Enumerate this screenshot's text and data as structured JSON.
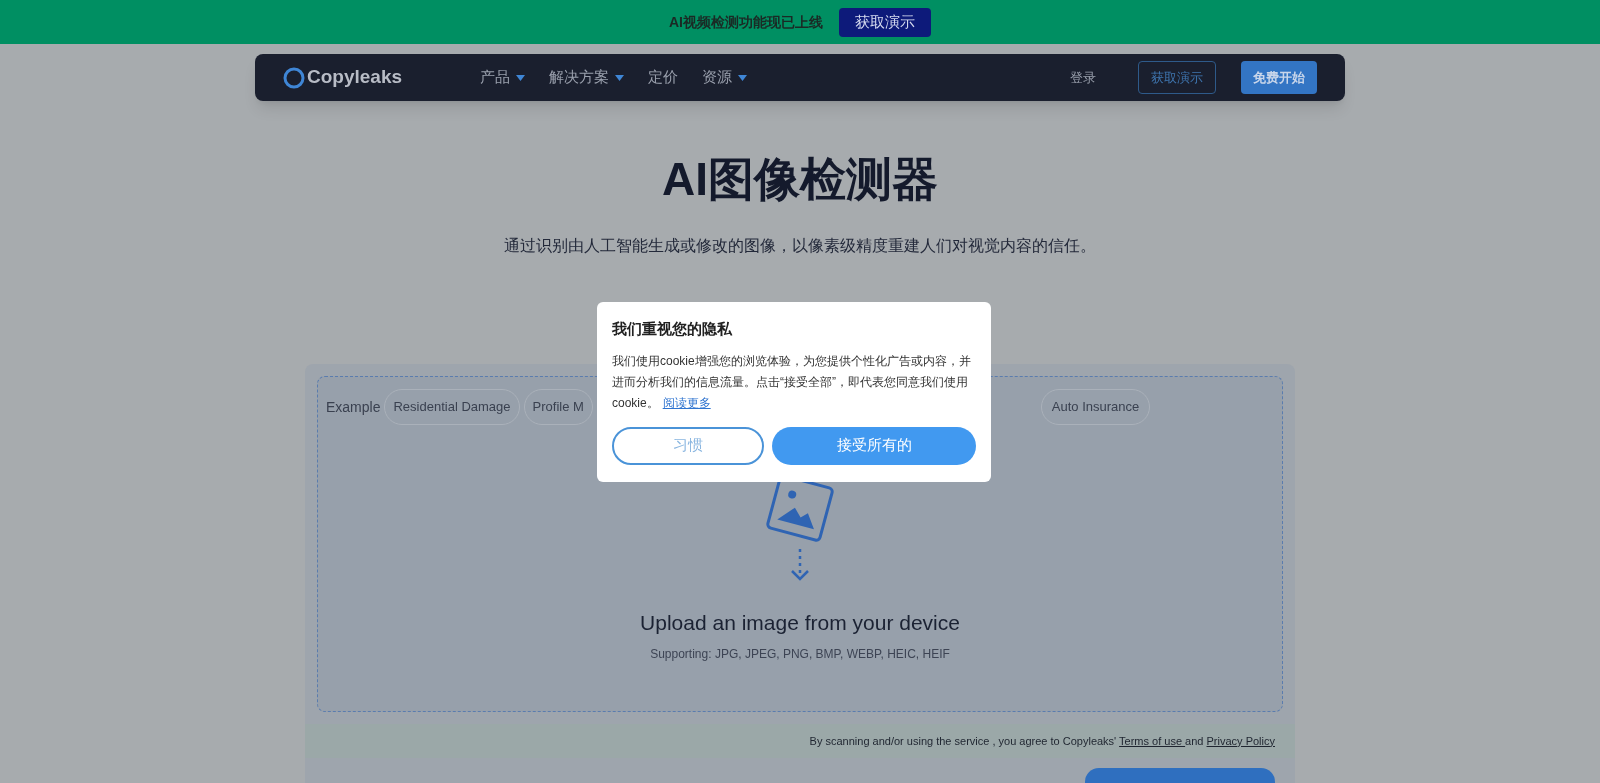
{
  "banner": {
    "text": "AI视频检测功能现已上线",
    "button": "获取演示"
  },
  "nav": {
    "logo": "Copyleaks",
    "items": [
      {
        "label": "产品",
        "dropdown": true
      },
      {
        "label": "解决方案",
        "dropdown": true
      },
      {
        "label": "定价",
        "dropdown": false
      },
      {
        "label": "资源",
        "dropdown": true
      }
    ],
    "login": "登录",
    "demo": "获取演示",
    "start": "免费开始"
  },
  "hero": {
    "title": "AI图像检测器",
    "subtitle": "通过识别由人工智能生成或修改的图像，以像素级精度重建人们对视觉内容的信任。"
  },
  "upload": {
    "example_label": "Example",
    "chips": [
      "Residential Damage",
      "Profile M"
    ],
    "chips_right": [
      "Auto Insurance"
    ],
    "heading": "Upload an image from your device",
    "formats": "Supporting: JPG, JPEG, PNG, BMP, WEBP, HEIC, HEIF",
    "terms_before": "By scanning and/or using the service , you agree to Copyleaks' ",
    "terms_link": "Terms of use ",
    "terms_and": "and ",
    "privacy_link": "Privacy Policy"
  },
  "cookie_dialog": {
    "title": "我们重视您的隐私",
    "body": "我们使用cookie增强您的浏览体验，为您提供个性化广告或内容，并进而分析我们的信息流量。点击“接受全部”，即代表您同意我们使用cookie。",
    "link": "阅读更多",
    "buttons": [
      {
        "label": "习惯",
        "kind": "outline"
      },
      {
        "label": "接受所有的",
        "kind": "primary"
      }
    ]
  }
}
